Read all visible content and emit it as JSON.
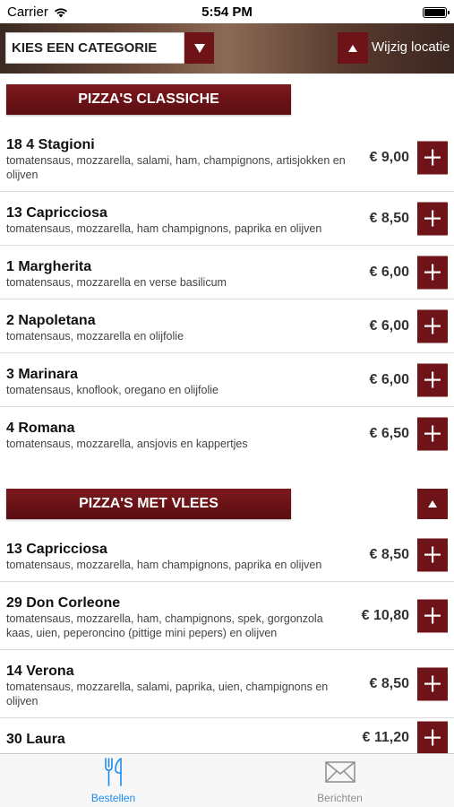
{
  "status_bar": {
    "carrier": "Carrier",
    "time": "5:54 PM"
  },
  "toolbar": {
    "category_placeholder": "KIES EEN CATEGORIE",
    "change_location_label": "Wijzig locatie"
  },
  "sections": [
    {
      "title": "PIZZA'S CLASSICHE",
      "items": [
        {
          "name": "18 4 Stagioni",
          "description": "tomatensaus, mozzarella, salami, ham, champignons, artisjokken en olijven",
          "price": "€ 9,00"
        },
        {
          "name": "13 Capricciosa",
          "description": "tomatensaus, mozzarella, ham champignons, paprika en olijven",
          "price": "€ 8,50"
        },
        {
          "name": "1 Margherita",
          "description": "tomatensaus, mozzarella en verse basilicum",
          "price": "€ 6,00"
        },
        {
          "name": "2 Napoletana",
          "description": "tomatensaus, mozzarella en olijfolie",
          "price": "€ 6,00"
        },
        {
          "name": "3 Marinara",
          "description": "tomatensaus, knoflook, oregano en olijfolie",
          "price": "€ 6,00"
        },
        {
          "name": "4 Romana",
          "description": "tomatensaus, mozzarella, ansjovis en kappertjes",
          "price": "€ 6,50"
        }
      ]
    },
    {
      "title": "PIZZA'S MET VLEES",
      "items": [
        {
          "name": "13 Capricciosa",
          "description": "tomatensaus, mozzarella, ham champignons, paprika en olijven",
          "price": "€ 8,50"
        },
        {
          "name": "29 Don Corleone",
          "description": "tomatensaus, mozzarella, ham, champignons, spek, gorgonzola kaas, uien, peperoncino (pittige mini pepers) en olijven",
          "price": "€ 10,80"
        },
        {
          "name": "14 Verona",
          "description": "tomatensaus, mozzarella, salami, paprika, uien, champignons en olijven",
          "price": "€ 8,50"
        },
        {
          "name": "30 Laura",
          "description": "",
          "price": "€ 11,20"
        }
      ]
    }
  ],
  "tab_bar": {
    "orders_label": "Bestellen",
    "messages_label": "Berichten"
  },
  "colors": {
    "accent": "#6e1418",
    "active_tab": "#1a8cf0",
    "inactive_tab": "#8e8e8e"
  }
}
